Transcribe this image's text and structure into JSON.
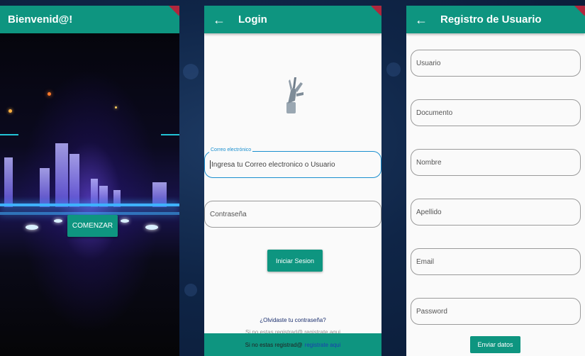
{
  "welcome_screen": {
    "title": "Bienvenid@!",
    "start_button": "COMENZAR"
  },
  "login_screen": {
    "title": "Login",
    "email_label": "Correo electrónico",
    "email_placeholder": "Ingresa tu Correo electronico o Usuario",
    "password_placeholder": "Contraseña",
    "login_button": "Iniciar Sesion",
    "forgot_password": "¿Olvidaste tu contraseña?",
    "faded_text": "Si no estas registrad@ registrate aqui",
    "register_prompt": "Si no estas registrad@",
    "register_link": "registrate aqui"
  },
  "register_screen": {
    "title": "Registro de Usuario",
    "fields": [
      "Usuario",
      "Documento",
      "Nombre",
      "Apellido",
      "Email",
      "Password"
    ],
    "submit_button": "Enviar datos"
  },
  "colors": {
    "accent": "#0e9580",
    "focus": "#1a8fcf",
    "debug_ribbon": "#b0273d"
  },
  "icons": [
    "back-arrow-icon",
    "robot-hand-illustration"
  ]
}
